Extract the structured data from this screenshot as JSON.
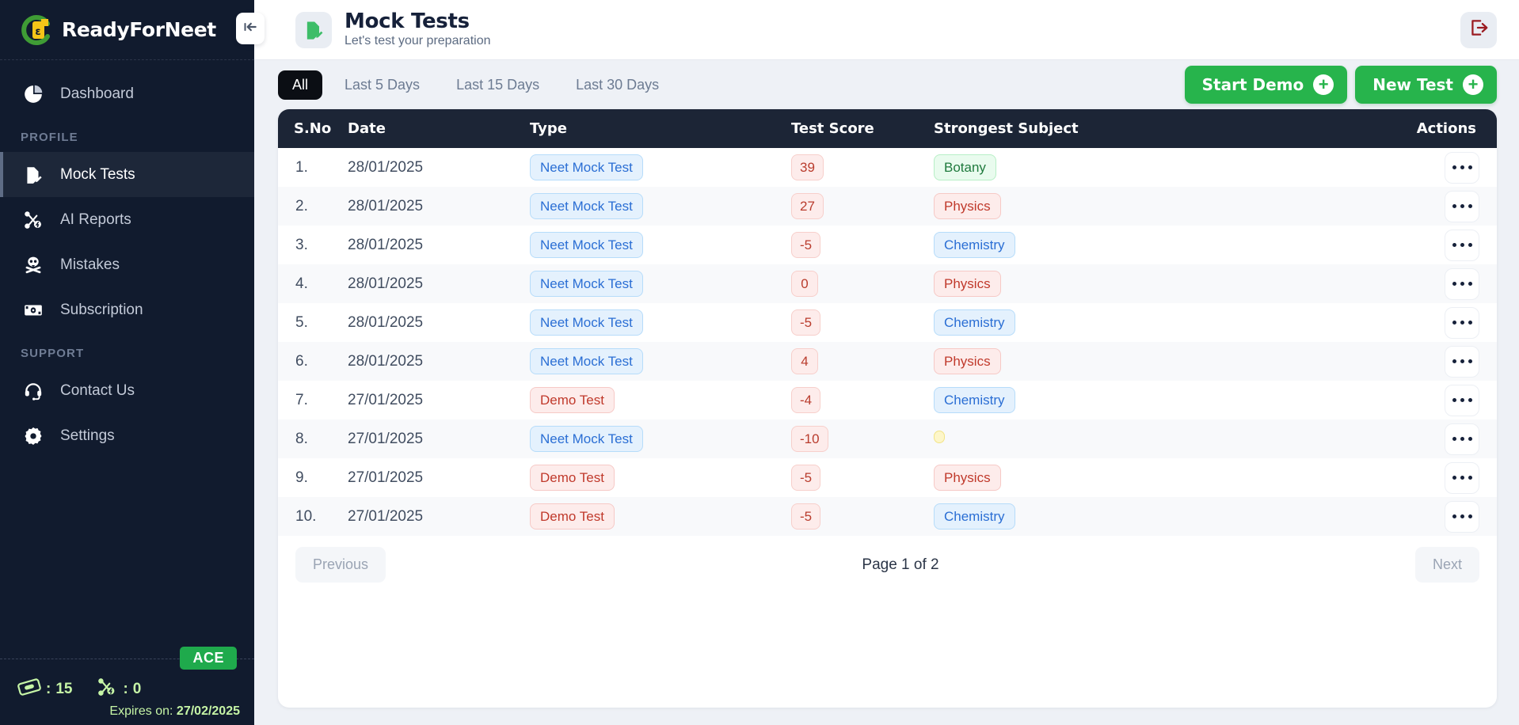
{
  "brand": {
    "name": "ReadyForNeet",
    "logo_icon": "readyforneet-logo-icon"
  },
  "sidebar": {
    "collapse_icon": "collapse-sidebar-icon",
    "top_items": [
      {
        "label": "Dashboard",
        "icon": "pie-chart-icon",
        "active": false
      }
    ],
    "sections": [
      {
        "title": "PROFILE",
        "items": [
          {
            "label": "Mock Tests",
            "icon": "document-edit-icon",
            "active": true
          },
          {
            "label": "AI Reports",
            "icon": "ai-nodes-icon",
            "active": false
          },
          {
            "label": "Mistakes",
            "icon": "skull-crossbones-icon",
            "active": false
          },
          {
            "label": "Subscription",
            "icon": "banknote-icon",
            "active": false
          }
        ]
      },
      {
        "title": "SUPPORT",
        "items": [
          {
            "label": "Contact Us",
            "icon": "headset-icon",
            "active": false
          },
          {
            "label": "Settings",
            "icon": "gear-icon",
            "active": false
          }
        ]
      }
    ],
    "footer": {
      "plan_badge": "ACE",
      "ticket_icon": "ticket-icon",
      "ticket_separator": ":",
      "ticket_count": "15",
      "ai_icon": "ai-nodes-icon",
      "ai_separator": ":",
      "ai_count": "0",
      "expires_label": "Expires on:",
      "expires_date": "27/02/2025"
    }
  },
  "header": {
    "icon": "document-edit-icon",
    "title": "Mock Tests",
    "subtitle": "Let's test your preparation",
    "logout_icon": "logout-icon"
  },
  "filters": {
    "tabs": [
      {
        "label": "All",
        "active": true
      },
      {
        "label": "Last 5 Days",
        "active": false
      },
      {
        "label": "Last 15 Days",
        "active": false
      },
      {
        "label": "Last 30 Days",
        "active": false
      }
    ],
    "start_demo_label": "Start Demo",
    "new_test_label": "New Test",
    "plus_glyph": "+"
  },
  "table": {
    "columns": [
      "S.No",
      "Date",
      "Type",
      "Test Score",
      "Strongest Subject",
      "Actions"
    ],
    "rows": [
      {
        "sno": "1.",
        "date": "28/01/2025",
        "type": "Neet Mock Test",
        "type_style": "blue",
        "score": "39",
        "subject": "Botany",
        "subject_style": "green"
      },
      {
        "sno": "2.",
        "date": "28/01/2025",
        "type": "Neet Mock Test",
        "type_style": "blue",
        "score": "27",
        "subject": "Physics",
        "subject_style": "red"
      },
      {
        "sno": "3.",
        "date": "28/01/2025",
        "type": "Neet Mock Test",
        "type_style": "blue",
        "score": "-5",
        "subject": "Chemistry",
        "subject_style": "blue"
      },
      {
        "sno": "4.",
        "date": "28/01/2025",
        "type": "Neet Mock Test",
        "type_style": "blue",
        "score": "0",
        "subject": "Physics",
        "subject_style": "red"
      },
      {
        "sno": "5.",
        "date": "28/01/2025",
        "type": "Neet Mock Test",
        "type_style": "blue",
        "score": "-5",
        "subject": "Chemistry",
        "subject_style": "blue"
      },
      {
        "sno": "6.",
        "date": "28/01/2025",
        "type": "Neet Mock Test",
        "type_style": "blue",
        "score": "4",
        "subject": "Physics",
        "subject_style": "red"
      },
      {
        "sno": "7.",
        "date": "27/01/2025",
        "type": "Demo Test",
        "type_style": "red",
        "score": "-4",
        "subject": "Chemistry",
        "subject_style": "blue"
      },
      {
        "sno": "8.",
        "date": "27/01/2025",
        "type": "Neet Mock Test",
        "type_style": "blue",
        "score": "-10",
        "subject": "",
        "subject_style": "yellow"
      },
      {
        "sno": "9.",
        "date": "27/01/2025",
        "type": "Demo Test",
        "type_style": "red",
        "score": "-5",
        "subject": "Physics",
        "subject_style": "red"
      },
      {
        "sno": "10.",
        "date": "27/01/2025",
        "type": "Demo Test",
        "type_style": "red",
        "score": "-5",
        "subject": "Chemistry",
        "subject_style": "blue"
      }
    ],
    "row_action_icon": "more-options-icon"
  },
  "pagination": {
    "previous_label": "Previous",
    "page_info": "Page 1 of 2",
    "next_label": "Next"
  },
  "colors": {
    "sidebar_bg": "#111b2e",
    "accent_green": "#27b44c",
    "table_header_bg": "#1c2536",
    "page_bg": "#eef1f6",
    "badge_plan": "#1faa4c",
    "credit_text": "#c6f5a6",
    "logout_red": "#9b1c22"
  }
}
